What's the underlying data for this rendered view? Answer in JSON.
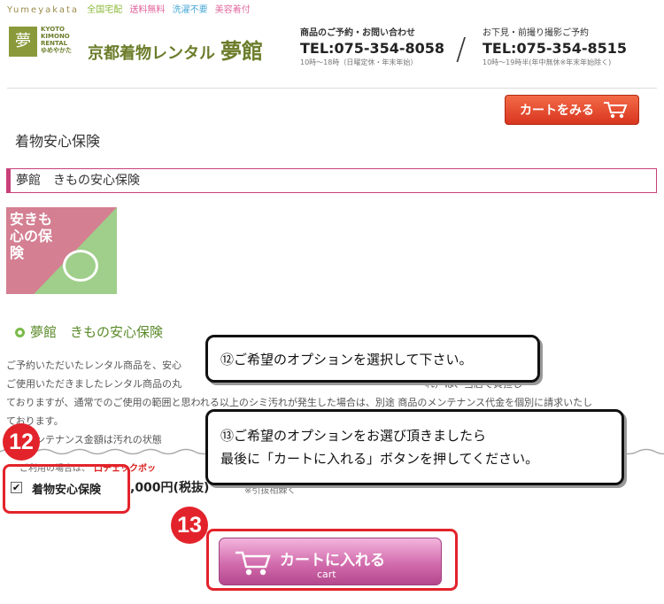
{
  "header": {
    "brand_roman": "Yumeyakata",
    "tags": [
      "全国宅配",
      "送料無料",
      "洗濯不要",
      "美容着付"
    ],
    "logo_mark": "夢",
    "logo_sub_lines": [
      "KYOTO",
      "KIMONO",
      "RENTAL",
      "ゆめやかた"
    ],
    "logo_name": "京都着物レンタル",
    "logo_name_kanji": "夢館",
    "contact1": {
      "label": "商品のご予約・お問い合わせ",
      "tel": "TEL:075-354-8058",
      "hours": "10時〜18時（日曜定休・年末年始）"
    },
    "contact2": {
      "label": "お下見・前撮り撮影ご予約",
      "tel": "TEL:075-354-8515",
      "hours": "10時〜19時半(年中無休※年末年始除く)"
    }
  },
  "cart_view_label": "カートをみる",
  "page_title": "着物安心保険",
  "section_title": "夢館　きもの安心保険",
  "product_image_text": "安きも心の保険",
  "sub_heading": "夢館　きもの安心保険",
  "body_lines": [
    "ご予約いただいたレンタル商品を、安心　　　　　　　　　　　　　　　　　　　　　　　　　　　　　　　　　た。",
    "ご使用いただきましたレンタル商品の丸　　　　　　　　　　　　　　　　　　　　　　　　　れ）は、当店で負担し",
    "ておりますが、通常でのご使用の範囲と思われる以上のシミ汚れが発生した場合は、別途 商品のメンテナンス代金を個別に請求いたし",
    "ております。",
    "　　メンテナンス金額は汚れの状態"
  ],
  "callout12": "⑫ご希望のオプションを選択して下さい。",
  "callout13": [
    "⑬ご希望のオプションをお選び頂きましたら",
    "最後に「カートに入れる」ボタンを押してください。"
  ],
  "badge12": "12",
  "badge13": "13",
  "check_label_prefix": "ご利用の場合は、",
  "check_label_red": "口チェックボッ",
  "option": {
    "checked": true,
    "name": "着物安心保険",
    "price": ",000円(税抜)",
    "note": "※引抜相棘く"
  },
  "add_to_cart": {
    "label": "カートに入れる",
    "sub": "cart"
  },
  "colors": {
    "accent_red": "#e3232b",
    "logo_green": "#6b7d2a",
    "cart_pink": "#d26cad"
  }
}
